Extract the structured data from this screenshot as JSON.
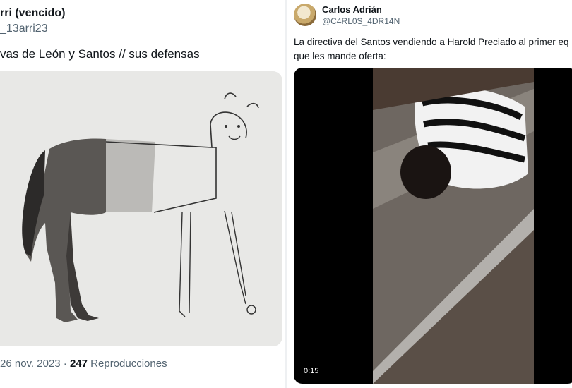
{
  "left_tweet": {
    "author_name": "rri (vencido)",
    "handle": "_13arri23",
    "text": "vas de León y Santos // sus defensas",
    "meta_date": "26 nov. 2023 ·",
    "meta_views": "247",
    "meta_views_label": "Reproducciones",
    "media_icon": "horse-drawing-image"
  },
  "right_tweet": {
    "author_name": "Carlos Adrián",
    "handle": "@C4RL0S_4DR14N",
    "text_line1": "La directiva del Santos vendiendo a Harold Preciado al primer eq",
    "text_line2": "que les mande oferta:",
    "video_time": "0:15",
    "avatar_icon": "avatar-image",
    "video_icon": "video-player"
  }
}
